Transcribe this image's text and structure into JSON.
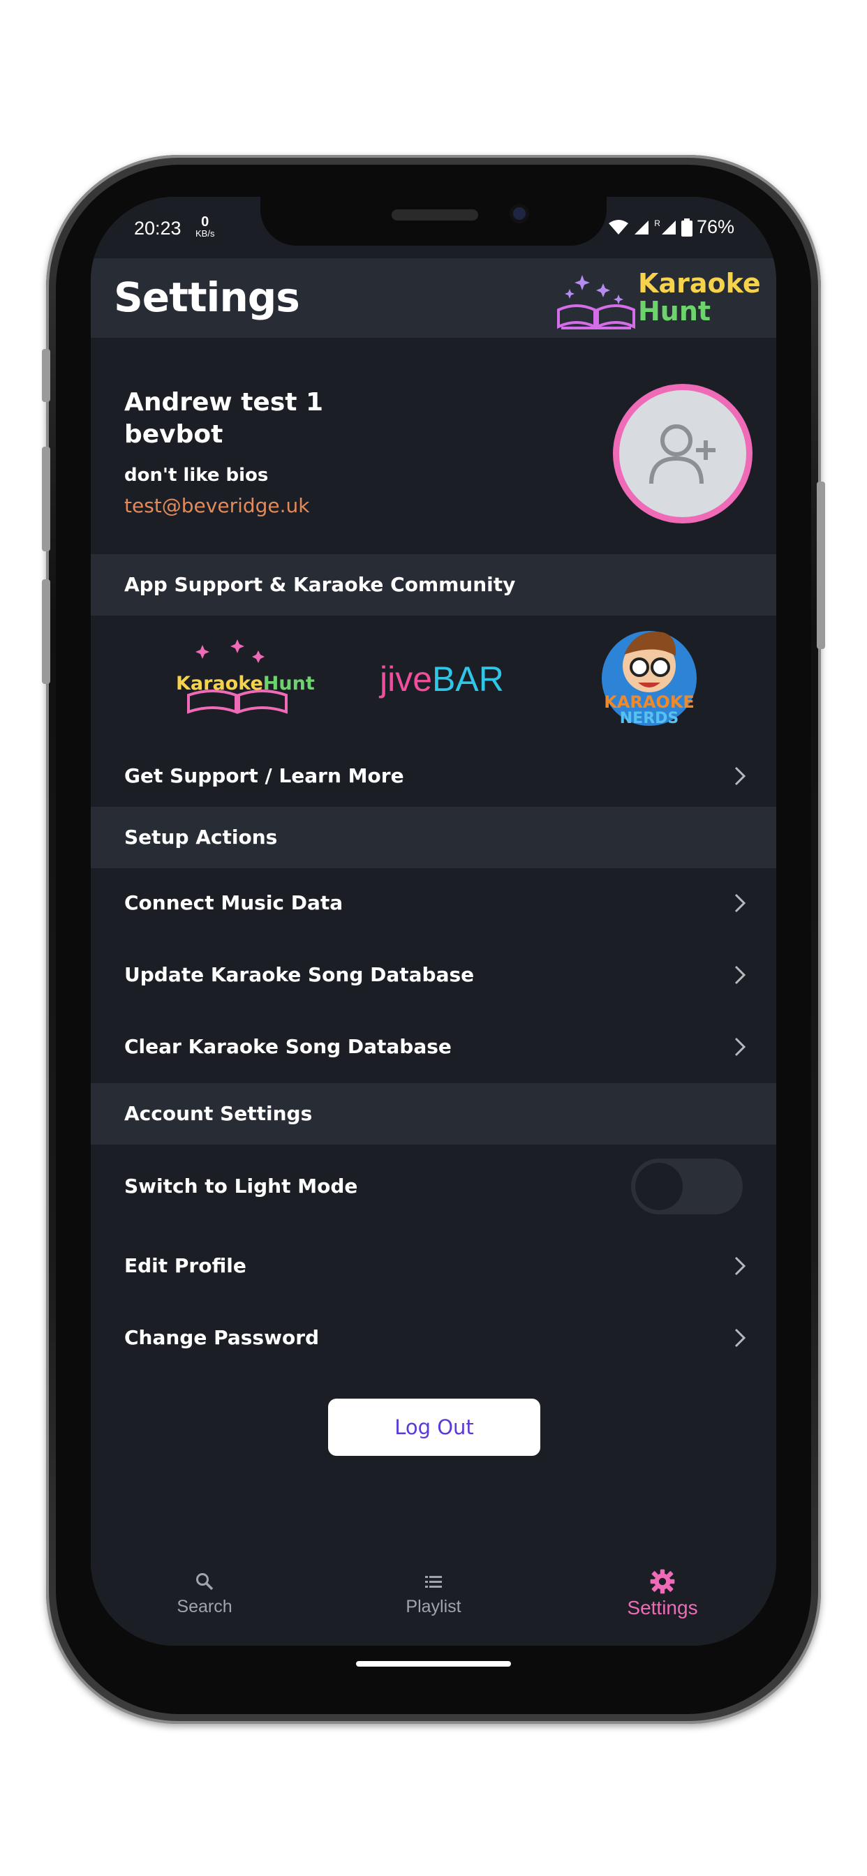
{
  "status_bar": {
    "time": "20:23",
    "speed_value": "0",
    "speed_unit": "KB/s",
    "battery": "76%",
    "network_label": "R"
  },
  "header": {
    "title": "Settings",
    "logo_line1": "Karaoke",
    "logo_line2": "Hunt"
  },
  "profile": {
    "name": "Andrew test 1",
    "username": "bevbot",
    "bio": "don't like bios",
    "email": "test@beveridge.uk"
  },
  "community": {
    "section_title": "App Support & Karaoke Community",
    "partner_logos": [
      {
        "text_a": "Karaoke",
        "text_b": "Hunt"
      },
      {
        "text_a": "jive",
        "text_b": "BAR"
      },
      {
        "text_a": "KARAOKE",
        "text_b": "NERDS"
      }
    ],
    "support_link": "Get Support / Learn More"
  },
  "setup": {
    "section_title": "Setup Actions",
    "items": [
      "Connect Music Data",
      "Update Karaoke Song Database",
      "Clear Karaoke Song Database"
    ]
  },
  "account": {
    "section_title": "Account Settings",
    "light_mode_label": "Switch to Light Mode",
    "light_mode_on": false,
    "items": [
      "Edit Profile",
      "Change Password"
    ]
  },
  "logout_label": "Log Out",
  "tabs": [
    {
      "label": "Search",
      "icon": "search-icon",
      "active": false
    },
    {
      "label": "Playlist",
      "icon": "list-icon",
      "active": false
    },
    {
      "label": "Settings",
      "icon": "gear-icon",
      "active": true
    }
  ],
  "colors": {
    "background": "#1b1e24",
    "section": "#282c35",
    "accent_pink": "#ef6bb8",
    "email": "#e38a5a",
    "logout_text": "#5b3ad8"
  }
}
